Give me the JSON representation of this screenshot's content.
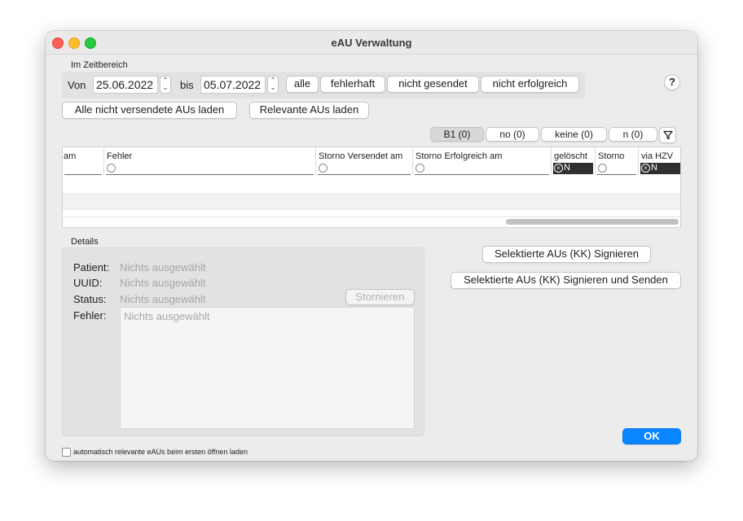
{
  "window": {
    "title": "eAU Verwaltung"
  },
  "zeitbereich": {
    "section_label": "Im Zeitbereich",
    "von_label": "Von",
    "von_value": "25.06.2022",
    "bis_label": "bis",
    "bis_value": "05.07.2022",
    "quick_buttons": [
      "alle",
      "fehlerhaft",
      "nicht gesendet",
      "nicht erfolgreich"
    ],
    "help_label": "?"
  },
  "load_buttons": {
    "load_unsent": "Alle nicht versendete AUs laden",
    "load_relevant": "Relevante AUs laden"
  },
  "filter_tabs": [
    {
      "label": "B1 (0)",
      "selected": true
    },
    {
      "label": "no (0)",
      "selected": false
    },
    {
      "label": "keine (0)",
      "selected": false
    },
    {
      "label": "n (0)",
      "selected": false
    }
  ],
  "filter_icon": "funnel-icon",
  "table": {
    "columns": [
      {
        "label": "am",
        "filter": "none"
      },
      {
        "label": "Fehler",
        "filter": "radio"
      },
      {
        "label": "Storno Versendet am",
        "filter": "radio"
      },
      {
        "label": "Storno Erfolgreich am",
        "filter": "radio"
      },
      {
        "label": "gelöscht",
        "filter": "N"
      },
      {
        "label": "Storno",
        "filter": "radio"
      },
      {
        "label": "via HZV",
        "filter": "N"
      }
    ],
    "filter_n_label": "N"
  },
  "details": {
    "section_label": "Details",
    "patient_label": "Patient:",
    "patient_value": "Nichts ausgewählt",
    "uuid_label": "UUID:",
    "uuid_value": "Nichts ausgewählt",
    "status_label": "Status:",
    "status_value": "Nichts ausgewählt",
    "fehler_label": "Fehler:",
    "fehler_value": "Nichts ausgewählt",
    "stornieren_label": "Stornieren"
  },
  "actions": {
    "sign": "Selektierte AUs (KK) Signieren",
    "sign_send": "Selektierte AUs (KK) Signieren und Senden",
    "ok": "OK"
  },
  "auto_load_checkbox": {
    "label": "automatisch relevante eAUs beim ersten öffnen laden",
    "checked": false
  },
  "colors": {
    "accent": "#0a84ff",
    "window_bg": "#ececec",
    "group_bg": "#e2e2e2"
  }
}
